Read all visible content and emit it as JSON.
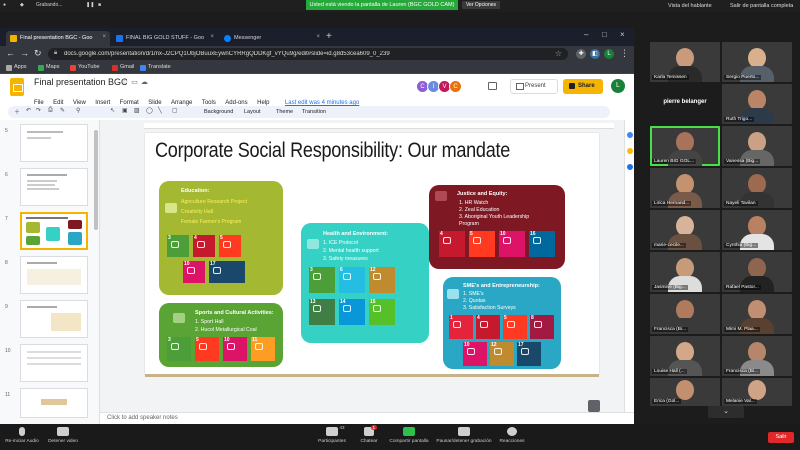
{
  "zoom_top": {
    "tabs": [
      "Grabando..."
    ],
    "share_banner": "Usted está viendo la pantalla de Lauren (BGC GOLD CAM)",
    "view_options": "Ver Opciones",
    "speaker_view": "Vista del hablante",
    "exit_fullscreen": "Salir de pantalla completa"
  },
  "browser": {
    "tabs": [
      {
        "label": "Final presentation BGC - Goo"
      },
      {
        "label": "FINAL BIG GOLD STUFF - Goo"
      },
      {
        "label": "Messenger"
      }
    ],
    "url": "docs.google.com/presentation/d/1mx-J2CPQ1UbjOBuuxEywnCYRRgQDDKgf_vYQu9g/edit#slide=id.g8d53cea609_0_239",
    "bookmarks": [
      "Apps",
      "Maps",
      "YouTube",
      "Gmail",
      "Translate"
    ]
  },
  "slides": {
    "doc_title": "Final presentation BGC",
    "menu": [
      "File",
      "Edit",
      "View",
      "Insert",
      "Format",
      "Slide",
      "Arrange",
      "Tools",
      "Add-ons",
      "Help"
    ],
    "last_edit": "Last edit was 4 minutes ago",
    "avatars": [
      "C",
      "I",
      "V",
      "C"
    ],
    "present_label": "Present",
    "share_label": "Share",
    "user_initial": "L",
    "toolbar": {
      "background": "Background",
      "layout": "Layout",
      "theme": "Theme",
      "transition": "Transition"
    },
    "speaker_notes": "Click to add speaker notes",
    "thumbnail_numbers": [
      "5",
      "6",
      "7",
      "8",
      "9",
      "10",
      "11"
    ]
  },
  "slide": {
    "title": "Corporate Social Responsibility: Our mandate",
    "education": {
      "title": "Education:",
      "items": [
        "Agriculture Research Project",
        "Creativity Hall",
        "Female Farmer's Program"
      ],
      "sdgs": [
        "3",
        "4",
        "5",
        "10",
        "17"
      ]
    },
    "health": {
      "title": "Health and Environment:",
      "items": [
        "1.  ICE Protocol",
        "2.  Mental health support",
        "3.  Safety measures"
      ],
      "sdgs": [
        "3",
        "6",
        "12",
        "13",
        "14",
        "15"
      ]
    },
    "justice": {
      "title": "Justice and Equity:",
      "items": [
        "1.  HR Watch",
        "2.  Zeal Education",
        "3.  Aboriginal Youth Leadership",
        "     Program"
      ],
      "sdgs": [
        "4",
        "5",
        "10",
        "16"
      ]
    },
    "sports": {
      "title": "Sports and Cultural Activities:",
      "items": [
        "1.  Sport Hall",
        "2.  Hucol Metallurgical Coal"
      ],
      "sdgs": [
        "3",
        "5",
        "10",
        "11"
      ]
    },
    "sme": {
      "title": "SME's and Entrepreneurship:",
      "items": [
        "1.  SME's",
        "2.  Quotas",
        "3.  Satisfaction Surveys"
      ],
      "sdgs": [
        "1",
        "4",
        "5",
        "8",
        "10",
        "12",
        "17"
      ]
    },
    "colors": {
      "education": "#a4b832",
      "health": "#34d1c4",
      "justice": "#7e1822",
      "sports": "#5aa335",
      "sme": "#2aa7c4"
    }
  },
  "participants": [
    "Karla Temissen",
    "Sergio Puerto...",
    "pierre belanger",
    "Ruth Trigo...",
    "Lauren BIG GOL...",
    "Vanessa (Big...",
    "Lirica Hernand...",
    "Nayeli Tavilan",
    "marie-cecile...",
    "Cynthia (Big...",
    "Jasmine (Big...",
    "Rafael Pastor...",
    "Francisca (Bi...",
    "Mimi M. Plaa...",
    "Louise Hall (...",
    "Francisca (Bi...",
    "Erica (Gol...",
    "Melanie Val..."
  ],
  "zoom_bottom": {
    "restart_audio": "Re-iniciar Audio",
    "stop_video": "Detener video",
    "participants": "Participantes",
    "participants_count": "43",
    "chat": "Chatear",
    "chat_badge": "1",
    "share_screen": "Compartir pantalla",
    "pause_recording": "Pausar/detener grabación",
    "reactions": "Reacciones",
    "leave": "Salir"
  }
}
